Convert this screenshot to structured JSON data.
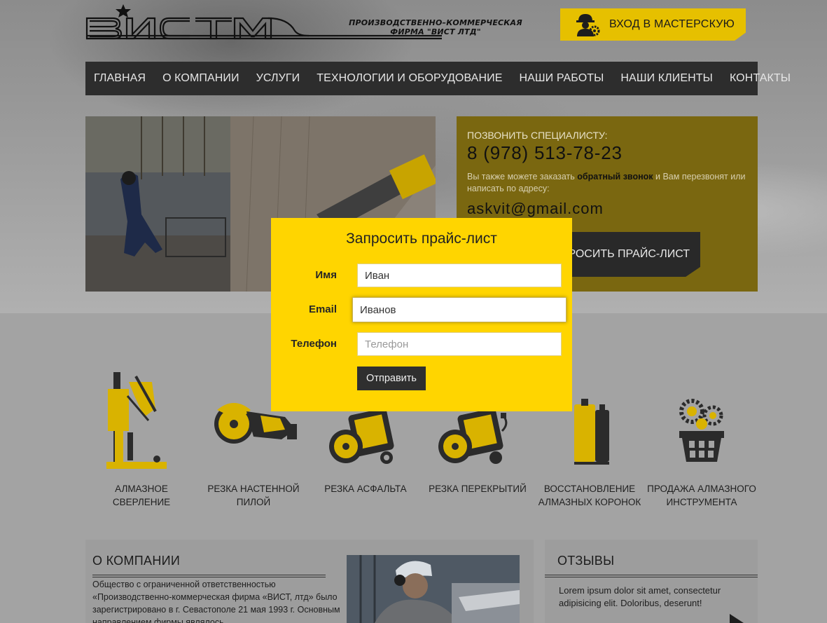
{
  "header": {
    "logo_line1": "ПРОИЗВОДСТВЕННО–КОММЕРЧЕСКАЯ",
    "logo_line2": "ФИРМА \"ВИСТ ЛТД\"",
    "logo_icon": "logo-vist",
    "login_label": "ВХОД В МАСТЕРСКУЮ",
    "login_icon": "worker-gear-icon"
  },
  "nav": {
    "items": [
      "ГЛАВНАЯ",
      "О КОМПАНИИ",
      "УСЛУГИ",
      "ТЕХНОЛОГИИ И ОБОРУДОВАНИЕ",
      "НАШИ РАБОТЫ",
      "НАШИ КЛИЕНТЫ",
      "КОНТАКТЫ"
    ]
  },
  "contact": {
    "call_label": "ПОЗВОНИТЬ СПЕЦИАЛИСТУ:",
    "phone": "8 (978) 513-78-23",
    "note_before": "Вы также можете заказать ",
    "note_bold": "обратный звонок",
    "note_after": " и Вам перезвонят или написать по адресу:",
    "email": "askvit@gmail.com",
    "price_button": "ПРОСИТЬ ПРАЙС-ЛИСТ"
  },
  "services": [
    {
      "label": "АЛМАЗНОЕ СВЕРЛЕНИЕ",
      "icon": "drill-rig-icon"
    },
    {
      "label": "РЕЗКА НАСТЕННОЙ ПИЛОЙ",
      "icon": "wall-saw-icon"
    },
    {
      "label": "РЕЗКА АСФАЛЬТА",
      "icon": "asphalt-cutter-icon"
    },
    {
      "label": "РЕЗКА ПЕРЕКРЫТИЙ",
      "icon": "floor-saw-icon"
    },
    {
      "label": "ВОССТАНОВЛЕНИЕ АЛМАЗНЫХ КОРОНОК",
      "icon": "core-bits-icon"
    },
    {
      "label": "ПРОДАЖА АЛМАЗНОГО ИНСТРУМЕНТА",
      "icon": "basket-gears-icon"
    }
  ],
  "about": {
    "title": "О КОМПАНИИ",
    "text": "Общество с ограниченной ответственностью «Производственно-коммерческая фирма «ВИСТ, лтд» было зарегистрировано в г. Севастополе 21 мая 1993 г. Основным направлением фирмы являлось"
  },
  "reviews": {
    "title": "ОТЗЫВЫ",
    "text": "Lorem ipsum dolor sit amet, consectetur adipisicing elit. Doloribus, deserunt!"
  },
  "modal": {
    "title": "Запросить прайс-лист",
    "name_label": "Имя",
    "name_value": "Иван",
    "email_label": "Email",
    "email_value": "Иванов",
    "phone_label": "Телефон",
    "phone_placeholder": "Телефон",
    "submit_label": "Отправить"
  },
  "colors": {
    "accent_yellow": "#ffd500",
    "nav_dark": "#2d2d2d",
    "icon_yellow": "#d9b300"
  }
}
